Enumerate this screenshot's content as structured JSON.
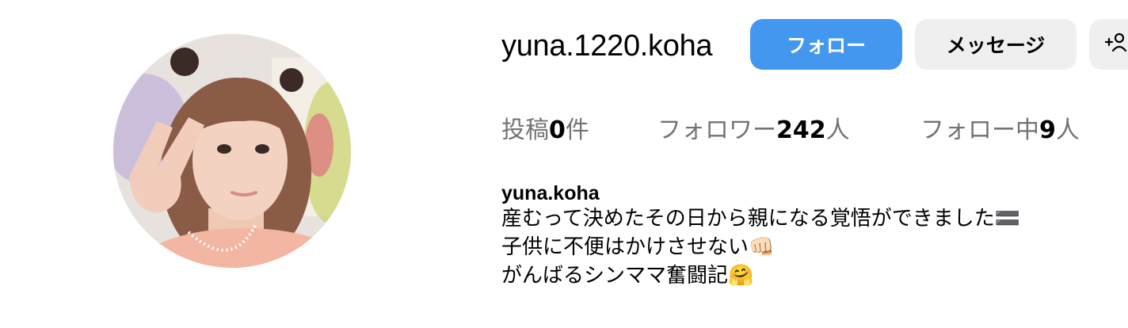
{
  "profile": {
    "username": "yuna.1220.koha",
    "display_name": "yuna.koha"
  },
  "actions": {
    "follow_label": "フォロー",
    "message_label": "メッセージ"
  },
  "stats": {
    "posts_prefix": "投稿",
    "posts_count": "0",
    "posts_suffix": "件",
    "followers_prefix": "フォロワー",
    "followers_count": "242",
    "followers_suffix": "人",
    "following_prefix": "フォロー中",
    "following_count": "9",
    "following_suffix": "人"
  },
  "bio": {
    "lines": [
      "産むって決めたその日から親になる覚悟ができました🟰",
      "子供に不便はかけさせない👊🏻",
      "がんばるシンママ奮闘記🤗"
    ]
  },
  "icons": {
    "add_user": "add-person-icon"
  },
  "colors": {
    "follow_button": "#4497ee",
    "secondary_button": "#efefef",
    "stat_label": "#737373"
  }
}
